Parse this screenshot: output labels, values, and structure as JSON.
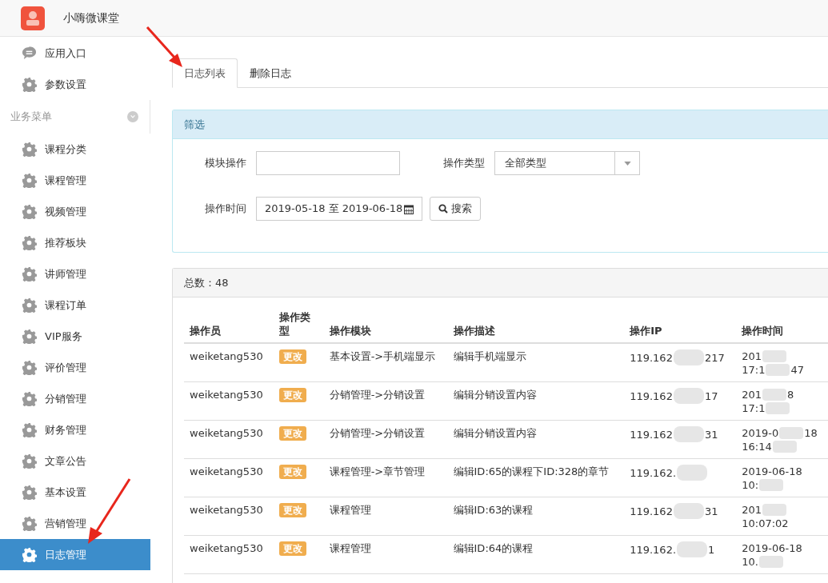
{
  "header": {
    "title": "小嗨微课堂"
  },
  "sidebar": {
    "top_items": [
      {
        "label": "应用入口",
        "kind": "chat"
      },
      {
        "label": "参数设置",
        "kind": "gear"
      }
    ],
    "section": {
      "label": "业务菜单",
      "expanded": true
    },
    "items": [
      {
        "label": "课程分类",
        "selected": false
      },
      {
        "label": "课程管理",
        "selected": false
      },
      {
        "label": "视频管理",
        "selected": false
      },
      {
        "label": "推荐板块",
        "selected": false
      },
      {
        "label": "讲师管理",
        "selected": false
      },
      {
        "label": "课程订单",
        "selected": false
      },
      {
        "label": "VIP服务",
        "selected": false
      },
      {
        "label": "评价管理",
        "selected": false
      },
      {
        "label": "分销管理",
        "selected": false
      },
      {
        "label": "财务管理",
        "selected": false
      },
      {
        "label": "文章公告",
        "selected": false
      },
      {
        "label": "基本设置",
        "selected": false
      },
      {
        "label": "营销管理",
        "selected": false
      },
      {
        "label": "日志管理",
        "selected": true
      }
    ]
  },
  "tabs": [
    {
      "label": "日志列表",
      "selected": true
    },
    {
      "label": "删除日志",
      "selected": false
    }
  ],
  "filter": {
    "title": "筛选",
    "module_label": "模块操作",
    "type_label": "操作类型",
    "type_value": "全部类型",
    "time_label": "操作时间",
    "time_value": "2019-05-18 至 2019-06-18",
    "search_button": "搜索"
  },
  "table": {
    "total": "总数：48",
    "columns": [
      "操作员",
      "操作类型",
      "操作模块",
      "操作描述",
      "操作IP",
      "操作时间"
    ],
    "rows": [
      {
        "operator": "weiketang530",
        "type": "更改",
        "module": "基本设置->手机端显示",
        "description": "编辑手机端显示",
        "ip_start": "119.162",
        "ip_end": "217",
        "time_lines": [
          {
            "start": "201",
            "blurred": true
          },
          {
            "start": "17:1",
            "end": "47",
            "blurred": true
          }
        ]
      },
      {
        "operator": "weiketang530",
        "type": "更改",
        "module": "分销管理->分销设置",
        "description": "编辑分销设置内容",
        "ip_start": "119.162",
        "ip_end": "17",
        "time_lines": [
          {
            "start": "201",
            "end": "8",
            "blurred": true
          },
          {
            "start": "17:1",
            "blurred": true
          }
        ]
      },
      {
        "operator": "weiketang530",
        "type": "更改",
        "module": "分销管理->分销设置",
        "description": "编辑分销设置内容",
        "ip_start": "119.162",
        "ip_end": "31",
        "time_lines": [
          {
            "start": "2019-0",
            "end": "18",
            "blurred": true
          },
          {
            "start": "16:14",
            "blurred": true
          }
        ]
      },
      {
        "operator": "weiketang530",
        "type": "更改",
        "module": "课程管理->章节管理",
        "description": "编辑ID:65的课程下ID:328的章节",
        "ip_start": "119.162.",
        "time_lines": [
          {
            "start": "2019-06-18",
            "blurred": false
          },
          {
            "start": "10:",
            "blurred": true
          }
        ]
      },
      {
        "operator": "weiketang530",
        "type": "更改",
        "module": "课程管理",
        "description": "编辑ID:63的课程",
        "ip_start": "119.162",
        "ip_end": "31",
        "time_lines": [
          {
            "start": "201",
            "blurred": true
          },
          {
            "start": "10:07:02",
            "blurred": false
          }
        ]
      },
      {
        "operator": "weiketang530",
        "type": "更改",
        "module": "课程管理",
        "description": "编辑ID:64的课程",
        "ip_start": "119.162.",
        "ip_end": "1",
        "time_lines": [
          {
            "start": "2019-06-18",
            "blurred": false
          },
          {
            "start": "10.",
            "blurred": true
          }
        ]
      }
    ]
  }
}
